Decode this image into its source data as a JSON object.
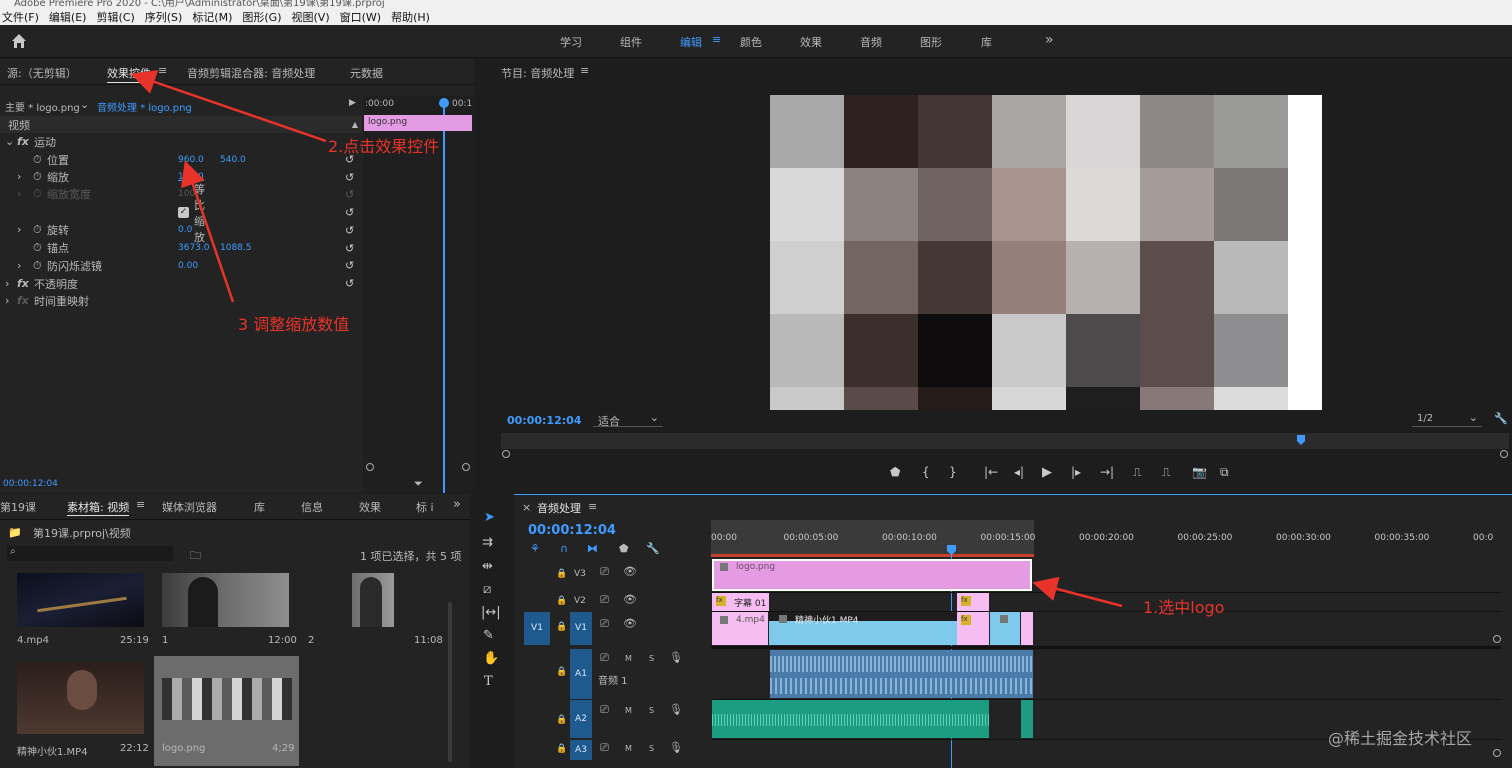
{
  "window": {
    "title": "Adobe Premiere Pro 2020 - C:\\用户\\Administrator\\桌面\\第19课\\第19课.prproj"
  },
  "menu": [
    "文件(F)",
    "编辑(E)",
    "剪辑(C)",
    "序列(S)",
    "标记(M)",
    "图形(G)",
    "视图(V)",
    "窗口(W)",
    "帮助(H)"
  ],
  "workspaces": [
    "学习",
    "组件",
    "编辑",
    "颜色",
    "效果",
    "音频",
    "图形",
    "库"
  ],
  "workspace_more": "»",
  "source_panel": {
    "tabs": [
      "源:（无剪辑）",
      "效果控件",
      "音频剪辑混合器: 音频处理",
      "元数据"
    ],
    "menu_icon": "≡",
    "master": "主要 * logo.png",
    "sequence": "音频处理 * logo.png",
    "mini_ruler_start": ":00:00",
    "mini_ruler_end": "00:1",
    "mini_clip": "logo.png",
    "section_video": "视频",
    "rows": [
      {
        "label": "运动",
        "type": "fx"
      },
      {
        "label": "位置",
        "v1": "960.0",
        "v2": "540.0"
      },
      {
        "label": "缩放",
        "v1": "100.0"
      },
      {
        "label": "缩放宽度",
        "v1": "100",
        "disabled": true
      },
      {
        "label": "等比缩放",
        "type": "checkbox"
      },
      {
        "label": "旋转",
        "v1": "0.0"
      },
      {
        "label": "锚点",
        "v1": "3673.0",
        "v2": "1088.5"
      },
      {
        "label": "防闪烁滤镜",
        "v1": "0.00"
      },
      {
        "label": "不透明度",
        "type": "fx"
      },
      {
        "label": "时间重映射",
        "type": "fx-disabled"
      }
    ],
    "timecode": "00:00:12:04"
  },
  "annotations": {
    "step1": "1.选中logo",
    "step2": "2.点击效果控件",
    "step3": "3 调整缩放数值",
    "color": "#e8332a"
  },
  "program_monitor": {
    "title": "节目: 音频处理",
    "timecode": "00:00:12:04",
    "fit": "适合",
    "quality": "1/2",
    "mosaic_colors": [
      [
        "#a9a9a9",
        "#2e2220",
        "#433532",
        "#aaa6a4",
        "#d8d6d6",
        "#8d8785",
        "#9a9a98"
      ],
      [
        "#d9d9d9",
        "#8b817f",
        "#6f6360",
        "#a8938e",
        "#dcd9d9",
        "#a59b98",
        "#7c7878"
      ],
      [
        "#cfcfcf",
        "#736560",
        "#433834",
        "#957f7b",
        "#b7b0b0",
        "#5d4e4b",
        "#b9b9b9"
      ],
      [
        "#b9b9b9",
        "#3b2e2b",
        "#0d0b0b",
        "#c9c9c9",
        "#4d4a4c",
        "#5c4c4b",
        "#8e8e90"
      ],
      [
        "#c9c9c9",
        "#5a4a48",
        "#251c1a",
        "#d7d7d7",
        "#1e1e1e",
        "#887877",
        "#dcdcdc"
      ]
    ]
  },
  "project_panel": {
    "tabs": [
      "第19课",
      "素材箱: 视频",
      "媒体浏览器",
      "库",
      "信息",
      "效果",
      "标 i"
    ],
    "path": "第19课.prproj\\视频",
    "selection": "1 项已选择，共 5 项",
    "items": [
      {
        "name": "4.mp4",
        "duration": "25:19"
      },
      {
        "name": "1",
        "duration": "12:00"
      },
      {
        "name": "2",
        "duration": "11:08"
      },
      {
        "name": "精神小伙1.MP4",
        "duration": "22:12"
      },
      {
        "name": "logo.png",
        "duration": "4;29"
      }
    ]
  },
  "timeline": {
    "title": "音频处理",
    "timecode": "00:00:12:04",
    "ruler": [
      "00:00",
      "00:00:05:00",
      "00:00:10:00",
      "00:00:15:00",
      "00:00:20:00",
      "00:00:25:00",
      "00:00:30:00",
      "00:00:35:00",
      "00:0"
    ],
    "tracks": {
      "v3": "V3",
      "v2": "V2",
      "v1": "V1",
      "a1": "A1",
      "a2": "A2",
      "a3": "A3",
      "src_v1": "V1",
      "a1_name": "音频 1",
      "m": "M",
      "s": "S"
    },
    "clips": {
      "logo": "logo.png",
      "subtitle": "字幕 01",
      "mp4": "4.mp4",
      "jingshen": "精神小伙1.MP4"
    }
  },
  "watermark": "@稀土掘金技术社区"
}
